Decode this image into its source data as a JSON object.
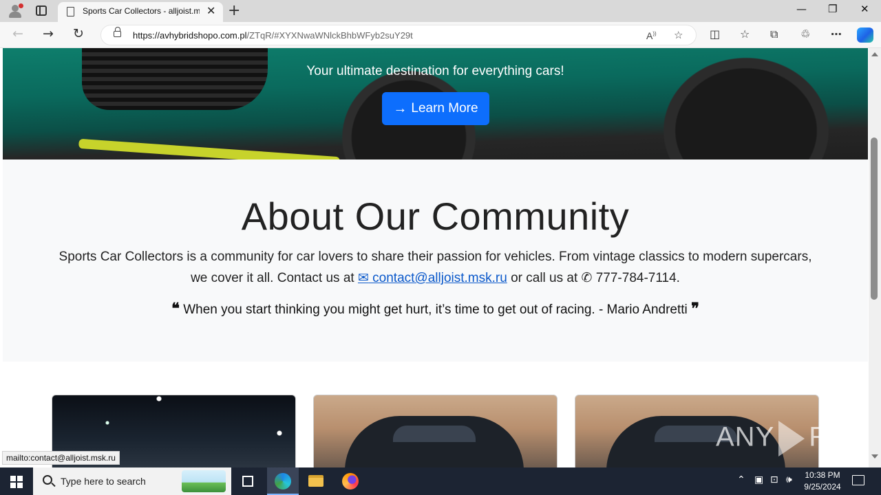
{
  "browser": {
    "tab_title": "Sports Car Collectors - alljoist.msk.ru",
    "tab_close": "✕",
    "new_tab": "+",
    "url_host": "https://avhybridshopo.com.pl",
    "url_path": "/ZTqR/#XYXNwaWNlckBhbWFyb2suY29t",
    "window_controls": {
      "minimize": "—",
      "restore": "❐",
      "close": "✕"
    },
    "nav": {
      "back": "←",
      "forward": "→",
      "refresh": "↻"
    }
  },
  "hero": {
    "subtitle": "Your ultimate destination for everything cars!",
    "button_label": "Learn More",
    "button_icon": "→"
  },
  "about": {
    "title": "About Our Community",
    "text_before": "Sports Car Collectors is a community for car lovers to share their passion for vehicles. From vintage classics to modern supercars, we cover it all. Contact us at",
    "email": " contact@alljoist.msk.ru",
    "text_mid": "or call us at",
    "phone": "777-784-7114",
    "text_end": ".",
    "quote": "When you start thinking you might get hurt, it’s time to get out of racing. - Mario Andretti",
    "quote_open": "❝",
    "quote_close": "❞"
  },
  "status_bar": "mailto:contact@alljoist.msk.ru",
  "watermark": {
    "left": "ANY",
    "right": "RUN"
  },
  "taskbar": {
    "search_placeholder": "Type here to search",
    "time": "10:38 PM",
    "date": "9/25/2024"
  },
  "icons": [
    "profile-icon",
    "tab-actions-icon",
    "page-icon",
    "lock-icon",
    "read-aloud-icon",
    "favorite-star-icon",
    "split-screen-icon",
    "favorites-icon",
    "collections-icon",
    "extensions-icon",
    "more-icon",
    "copilot-icon",
    "envelope-icon",
    "phone-icon",
    "quote-icon",
    "windows-start-icon",
    "search-icon",
    "task-view-icon",
    "edge-icon",
    "file-explorer-icon",
    "firefox-icon",
    "chevron-up-icon",
    "network-icon",
    "volume-icon",
    "notification-icon"
  ],
  "colors": {
    "primary_button": "#0d6efd",
    "link": "#0a58ca",
    "section_bg": "#f8f9fa",
    "taskbar": "#1c2433"
  }
}
